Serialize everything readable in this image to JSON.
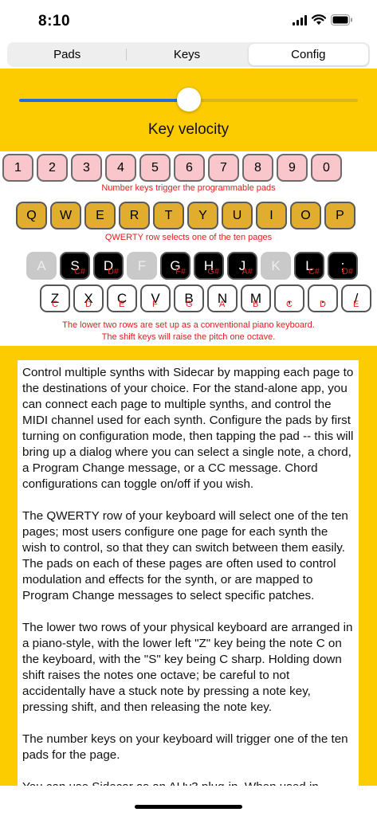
{
  "status_bar": {
    "time": "8:10"
  },
  "tabs": [
    {
      "label": "Pads",
      "selected": false
    },
    {
      "label": "Keys",
      "selected": false
    },
    {
      "label": "Config",
      "selected": true
    }
  ],
  "velocity": {
    "label": "Key velocity",
    "value": 0.5
  },
  "number_keys": [
    "1",
    "2",
    "3",
    "4",
    "5",
    "6",
    "7",
    "8",
    "9",
    "0"
  ],
  "number_caption": "Number keys trigger the programmable pads",
  "qwerty_keys": [
    "Q",
    "W",
    "E",
    "R",
    "T",
    "Y",
    "U",
    "I",
    "O",
    "P"
  ],
  "qwerty_caption": "QWERTY row selects one of the ten pages",
  "black_keys": [
    {
      "label": "A",
      "note": "",
      "active": false
    },
    {
      "label": "S",
      "note": "C#",
      "active": true
    },
    {
      "label": "D",
      "note": "D#",
      "active": true
    },
    {
      "label": "F",
      "note": "",
      "active": false
    },
    {
      "label": "G",
      "note": "F#",
      "active": true
    },
    {
      "label": "H",
      "note": "G#",
      "active": true
    },
    {
      "label": "J",
      "note": "A#",
      "active": true
    },
    {
      "label": "K",
      "note": "",
      "active": false
    },
    {
      "label": "L",
      "note": "C#",
      "active": true
    },
    {
      "label": ";",
      "note": "D#",
      "active": true
    }
  ],
  "white_keys": [
    {
      "label": "Z",
      "note": "C"
    },
    {
      "label": "X",
      "note": "D"
    },
    {
      "label": "C",
      "note": "E"
    },
    {
      "label": "V",
      "note": "F"
    },
    {
      "label": "B",
      "note": "G"
    },
    {
      "label": "N",
      "note": "A"
    },
    {
      "label": "M",
      "note": "B"
    },
    {
      "label": ",",
      "note": "C"
    },
    {
      "label": ".",
      "note": "D"
    },
    {
      "label": "/",
      "note": "E"
    }
  ],
  "piano_caption_1": "The lower two rows are set up as a conventional piano keyboard.",
  "piano_caption_2": "The shift keys will raise the pitch one octave.",
  "help_paragraphs": [
    "Control multiple synths with Sidecar by mapping each page to the destinations of your choice.  For the stand-alone app, you can connect each page to multiple synths, and control the MIDI channel used for each synth.  Configure the pads by first turning on configuration mode, then tapping the pad -- this will bring up a dialog where you can select a single note, a chord, a Program Change message, or a CC message.  Chord configurations can toggle on/off if you wish.",
    "The QWERTY row of your keyboard will select one of the ten pages; most users configure one page for each synth the wish to control, so that they can switch between them easily.  The pads on each of these pages are often used to control modulation and effects for the synth, or are mapped to Program Change messages to select specific patches.",
    "The lower two rows of your physical keyboard are arranged in a piano-style, with the lower left \"Z\" key being the note C on the keyboard, with the \"S\" key being C sharp.  Holding down shift raises the notes one octave; be careful to not accidentally have a stuck note by pressing a note key, pressing shift, and then releasing the note key.",
    "The number keys on your keyboard will trigger one of the ten pads for the page.",
    "You can use Sidecar as an AUv3 plug-in.  When used in"
  ]
}
